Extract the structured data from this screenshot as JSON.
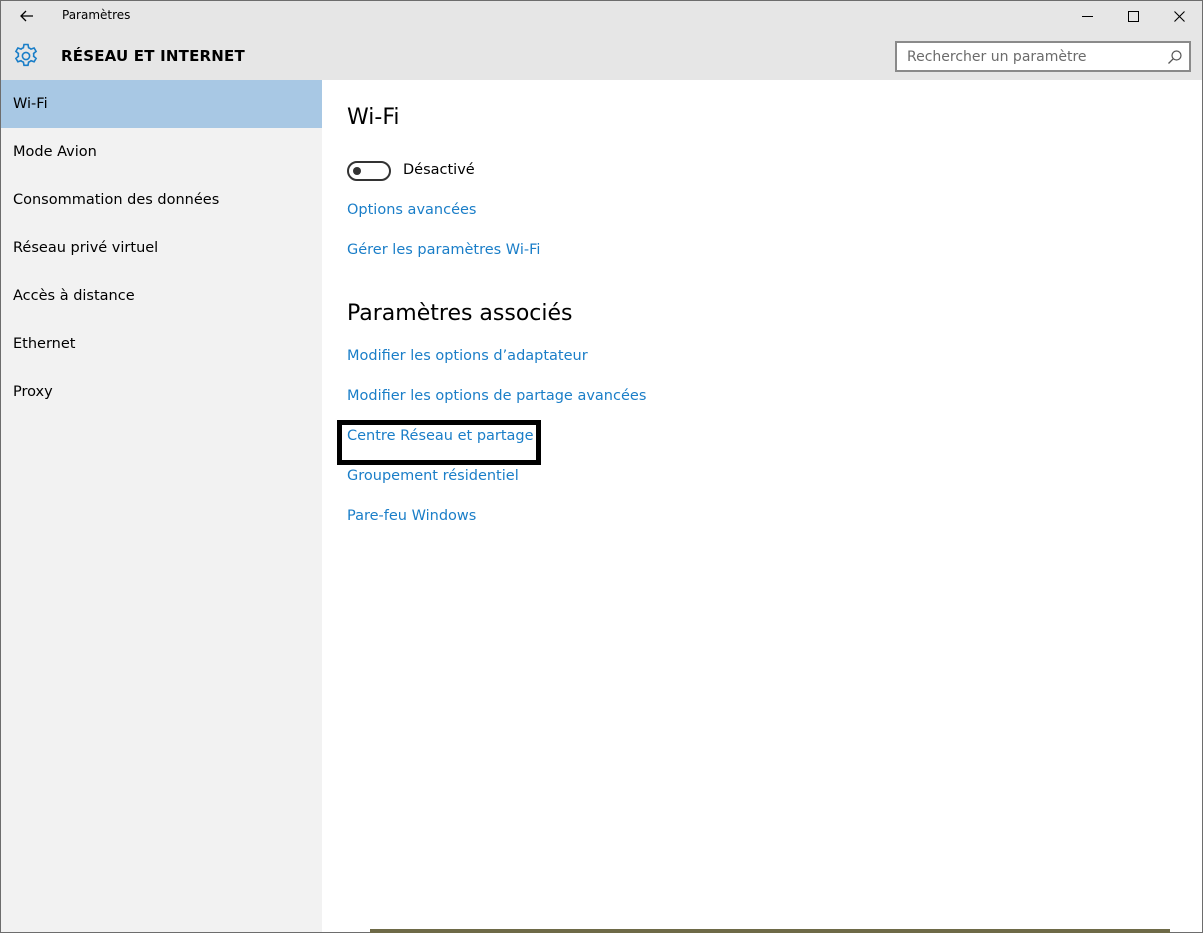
{
  "window": {
    "title": "Paramètres"
  },
  "header": {
    "title": "RÉSEAU ET INTERNET",
    "search_placeholder": "Rechercher un paramètre"
  },
  "sidebar": {
    "items": [
      {
        "label": "Wi-Fi",
        "active": true
      },
      {
        "label": "Mode Avion"
      },
      {
        "label": "Consommation des données"
      },
      {
        "label": "Réseau privé virtuel"
      },
      {
        "label": "Accès à distance"
      },
      {
        "label": "Ethernet"
      },
      {
        "label": "Proxy"
      }
    ]
  },
  "main": {
    "wifi_title": "Wi-Fi",
    "wifi_toggle_state": "Désactivé",
    "wifi_links": [
      "Options avancées",
      "Gérer les paramètres Wi-Fi"
    ],
    "related_title": "Paramètres associés",
    "related_links": [
      "Modifier les options d’adaptateur",
      "Modifier les options de partage avancées",
      "Centre Réseau et partage",
      "Groupement résidentiel",
      "Pare-feu Windows"
    ]
  },
  "colors": {
    "accent": "#1a7ec8",
    "active_nav": "#a8c8e4",
    "sidebar_bg": "#f2f2f2",
    "header_bg": "#e6e6e6"
  },
  "icons": {
    "back": "back-arrow-icon",
    "header": "gear-icon",
    "search": "search-icon"
  }
}
